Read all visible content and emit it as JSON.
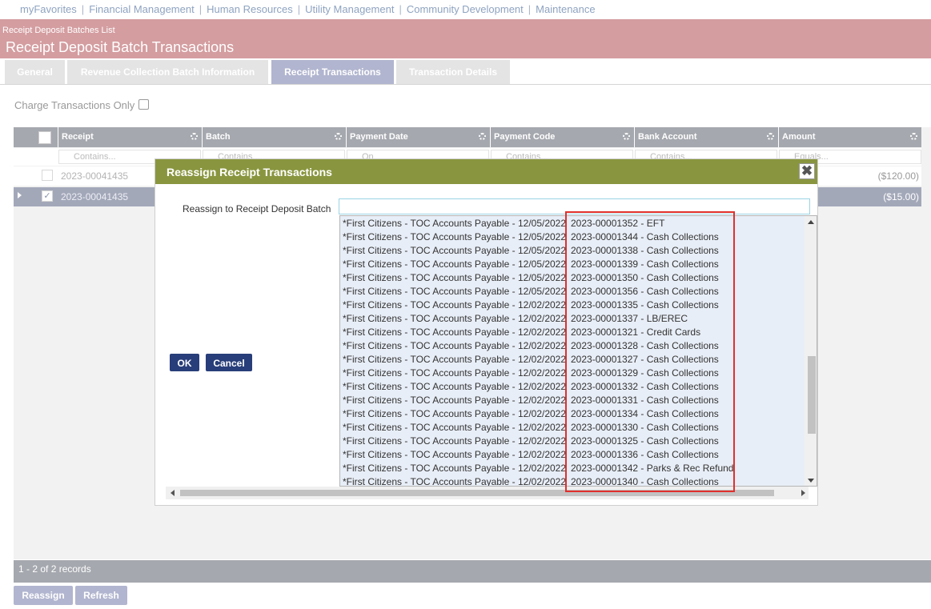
{
  "nav": {
    "items": [
      "myFavorites",
      "Financial Management",
      "Human Resources",
      "Utility Management",
      "Community Development",
      "Maintenance"
    ],
    "separator": "|"
  },
  "header": {
    "breadcrumb": "Receipt Deposit Batches List",
    "title": "Receipt Deposit Batch Transactions"
  },
  "tabs": [
    {
      "label": "General"
    },
    {
      "label": "Revenue Collection Batch Information"
    },
    {
      "label": "Receipt Transactions"
    },
    {
      "label": "Transaction Details"
    }
  ],
  "filter": {
    "charge_only_label": "Charge Transactions Only"
  },
  "grid": {
    "columns": [
      "Receipt",
      "Batch",
      "Payment Date",
      "Payment Code",
      "Bank Account",
      "Amount"
    ],
    "filter_placeholders": [
      "Contains...",
      "Contains...",
      "On",
      "Contains...",
      "Contains...",
      "Equals..."
    ],
    "rows": [
      {
        "receipt": "2023-00041435",
        "amount": "($120.00)",
        "checked": false
      },
      {
        "receipt": "2023-00041435",
        "amount": "($15.00)",
        "checked": true
      }
    ],
    "footer": "1 - 2 of 2 records",
    "check_glyph": "✓"
  },
  "buttons": {
    "reassign": "Reassign",
    "refresh": "Refresh"
  },
  "modal": {
    "title": "Reassign Receipt Transactions",
    "close_glyph": "✖",
    "field_label": "Reassign to Receipt Deposit Batch",
    "ok": "OK",
    "cancel": "Cancel",
    "options": [
      {
        "bank": "*First Citizens - TOC Accounts Payable - 12/05/2022",
        "batch": "2023-00001352 - EFT"
      },
      {
        "bank": "*First Citizens - TOC Accounts Payable - 12/05/2022",
        "batch": "2023-00001344 - Cash Collections"
      },
      {
        "bank": "*First Citizens - TOC Accounts Payable - 12/05/2022",
        "batch": "2023-00001338 - Cash Collections"
      },
      {
        "bank": "*First Citizens - TOC Accounts Payable - 12/05/2022",
        "batch": "2023-00001339 - Cash Collections"
      },
      {
        "bank": "*First Citizens - TOC Accounts Payable - 12/05/2022",
        "batch": "2023-00001350 - Cash Collections"
      },
      {
        "bank": "*First Citizens - TOC Accounts Payable - 12/05/2022",
        "batch": "2023-00001356 - Cash Collections"
      },
      {
        "bank": "*First Citizens - TOC Accounts Payable - 12/02/2022",
        "batch": "2023-00001335 - Cash Collections"
      },
      {
        "bank": "*First Citizens - TOC Accounts Payable - 12/02/2022",
        "batch": "2023-00001337 - LB/EREC"
      },
      {
        "bank": "*First Citizens - TOC Accounts Payable - 12/02/2022",
        "batch": "2023-00001321 - Credit Cards"
      },
      {
        "bank": "*First Citizens - TOC Accounts Payable - 12/02/2022",
        "batch": "2023-00001328 - Cash Collections"
      },
      {
        "bank": "*First Citizens - TOC Accounts Payable - 12/02/2022",
        "batch": "2023-00001327 - Cash Collections"
      },
      {
        "bank": "*First Citizens - TOC Accounts Payable - 12/02/2022",
        "batch": "2023-00001329 - Cash Collections"
      },
      {
        "bank": "*First Citizens - TOC Accounts Payable - 12/02/2022",
        "batch": "2023-00001332 - Cash Collections"
      },
      {
        "bank": "*First Citizens - TOC Accounts Payable - 12/02/2022",
        "batch": "2023-00001331 - Cash Collections"
      },
      {
        "bank": "*First Citizens - TOC Accounts Payable - 12/02/2022",
        "batch": "2023-00001334 - Cash Collections"
      },
      {
        "bank": "*First Citizens - TOC Accounts Payable - 12/02/2022",
        "batch": "2023-00001330 - Cash Collections"
      },
      {
        "bank": "*First Citizens - TOC Accounts Payable - 12/02/2022",
        "batch": "2023-00001325 - Cash Collections"
      },
      {
        "bank": "*First Citizens - TOC Accounts Payable - 12/02/2022",
        "batch": "2023-00001336 - Cash Collections"
      },
      {
        "bank": "*First Citizens - TOC Accounts Payable - 12/02/2022",
        "batch": "2023-00001342 - Parks & Rec Refund"
      },
      {
        "bank": "*First Citizens - TOC Accounts Payable - 12/02/2022",
        "batch": "2023-00001340 - Cash Collections"
      }
    ]
  },
  "colors": {
    "header_bg": "#d49da0",
    "modal_header_bg": "#8a963f",
    "primary_button": "#283e7a",
    "secondary_button": "#b1b5cf",
    "active_tab": "#b1b5cf",
    "highlight_border": "#e0302c"
  }
}
